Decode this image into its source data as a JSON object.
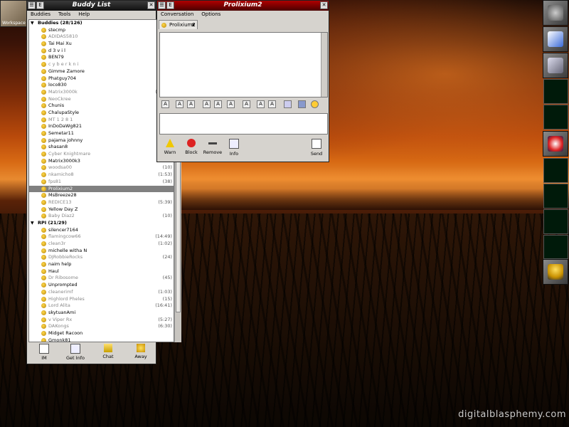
{
  "desktop": {
    "watermark": "digitalblasphemy.com",
    "workspace_label": "Workspace"
  },
  "buddy_window": {
    "title": "Buddy List",
    "menu": [
      "Buddies",
      "Tools",
      "Help"
    ],
    "groups": [
      {
        "name": "Buddies (28/126)",
        "buddies": [
          {
            "name": "stecmp",
            "idle": ""
          },
          {
            "name": "ADIDAS5810",
            "idle": "(26)"
          },
          {
            "name": "Tai Mai Xu",
            "idle": ""
          },
          {
            "name": "d 3 v i l",
            "idle": ""
          },
          {
            "name": "BEN79",
            "idle": ""
          },
          {
            "name": "c y b e r k n i",
            "idle": "(15)"
          },
          {
            "name": "Gimme Zamore",
            "idle": ""
          },
          {
            "name": "Phatguy704",
            "idle": ""
          },
          {
            "name": "loco830",
            "idle": ""
          },
          {
            "name": "Matrix3000k",
            "idle": "(20:45)"
          },
          {
            "name": "NeoCkree",
            "idle": "(50)"
          },
          {
            "name": "Chunis",
            "idle": ""
          },
          {
            "name": "ChalupaStyle",
            "idle": ""
          },
          {
            "name": "MT 1 2 8 1",
            "idle": "(58)"
          },
          {
            "name": "InDoDaWg821",
            "idle": ""
          },
          {
            "name": "Semetar11",
            "idle": ""
          },
          {
            "name": "pajama johnny",
            "idle": ""
          },
          {
            "name": "shasan8",
            "idle": ""
          },
          {
            "name": "Cyber Knightmare",
            "idle": "(26)"
          },
          {
            "name": "Matrix3000k3",
            "idle": ""
          },
          {
            "name": "woodsa00",
            "idle": "(10)"
          },
          {
            "name": "nkamicho8",
            "idle": "(1:53)"
          },
          {
            "name": "fps81",
            "idle": "(38)"
          },
          {
            "name": "Prolixium2",
            "idle": "",
            "selected": true
          },
          {
            "name": "MsBreeze28",
            "idle": ""
          },
          {
            "name": "REDICE13",
            "idle": "(5:39)"
          },
          {
            "name": "Yellow Day Z",
            "idle": ""
          },
          {
            "name": "Baby Diaz2",
            "idle": "(10)"
          }
        ]
      },
      {
        "name": "RPI (21/29)",
        "buddies": [
          {
            "name": "silencer7164",
            "idle": ""
          },
          {
            "name": "flamingcow66",
            "idle": "(14:49)"
          },
          {
            "name": "clean3r",
            "idle": "(1:02)"
          },
          {
            "name": "michelle witha N",
            "idle": ""
          },
          {
            "name": "DJRobbieRocks",
            "idle": "(24)"
          },
          {
            "name": "naim help",
            "idle": ""
          },
          {
            "name": "Haul",
            "idle": ""
          },
          {
            "name": "Dr Ribosome",
            "idle": "(45)"
          },
          {
            "name": "Unprompted",
            "idle": ""
          },
          {
            "name": "cleanerimf",
            "idle": "(1:03)"
          },
          {
            "name": "Highlord Pheles",
            "idle": "(15)"
          },
          {
            "name": "Lord Alita",
            "idle": "(16:41)"
          },
          {
            "name": "skytuanAmi",
            "idle": ""
          },
          {
            "name": "v Viper Rx",
            "idle": "(5:27)"
          },
          {
            "name": "DAKongs",
            "idle": "(6:30)"
          },
          {
            "name": "Midget Racoon",
            "idle": ""
          },
          {
            "name": "Gmonk81",
            "idle": ""
          }
        ]
      }
    ],
    "buttons": {
      "im": "IM",
      "get_info": "Get Info",
      "chat": "Chat",
      "away": "Away"
    }
  },
  "conv_window": {
    "title": "Prolixium2",
    "menu": [
      "Conversation",
      "Options"
    ],
    "tab_label": "Prolixium2",
    "tab_close": "x",
    "format_buttons": [
      "A",
      "A",
      "A",
      "A",
      "A",
      "A",
      "A",
      "A",
      "A"
    ],
    "buttons": {
      "warn": "Warn",
      "block": "Block",
      "remove": "Remove",
      "info": "Info",
      "send": "Send"
    }
  },
  "titlebar_glyphs": {
    "menu": "☰",
    "e": "E",
    "close": "✕"
  },
  "colors": {
    "active_title": "#b00000",
    "inactive_title": "#111111",
    "selection": "#808080",
    "buddy_icon": "#e8b820"
  }
}
